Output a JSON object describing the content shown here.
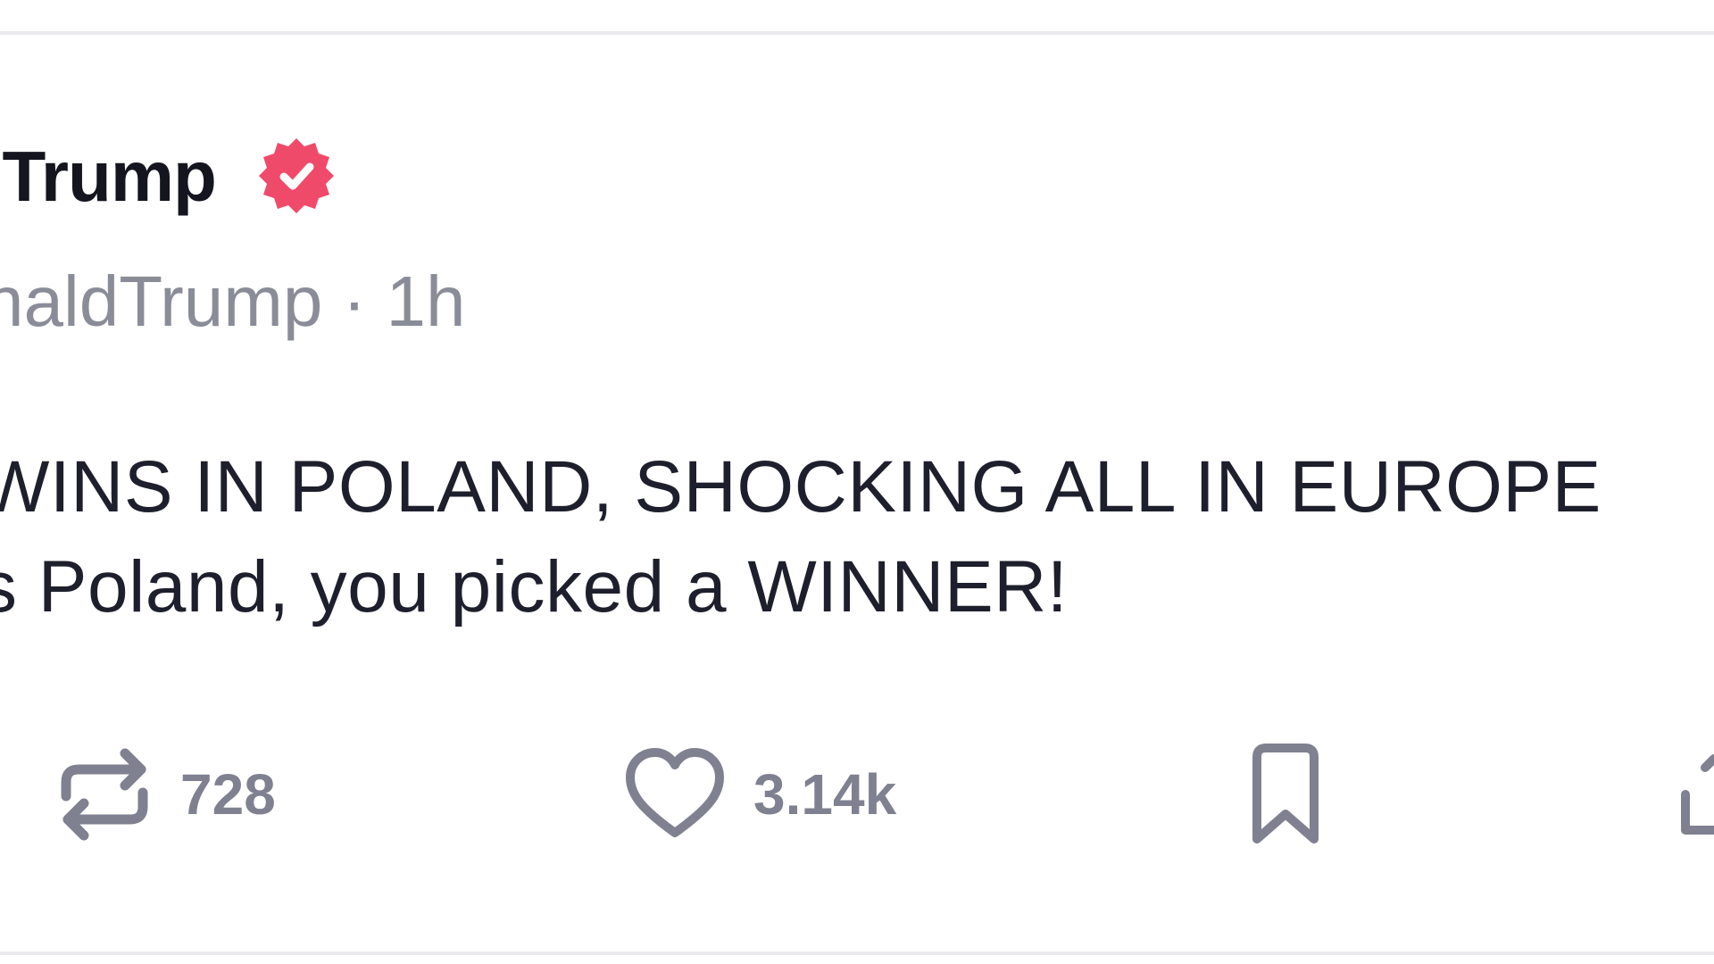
{
  "post": {
    "display_name": ". Trump",
    "handle_time": "naldTrump · 1h",
    "body_line_1": "WINS IN POLAND, SHOCKING ALL IN EUROPE",
    "body_line_2": "s Poland, you picked a WINNER!",
    "verified_badge_color": "#f04a6a"
  },
  "actions": {
    "repost": {
      "icon": "repost-icon",
      "count": "728"
    },
    "like": {
      "icon": "heart-icon",
      "count": "3.14k"
    },
    "bookmark": {
      "icon": "bookmark-icon"
    },
    "share": {
      "icon": "share-icon"
    }
  }
}
